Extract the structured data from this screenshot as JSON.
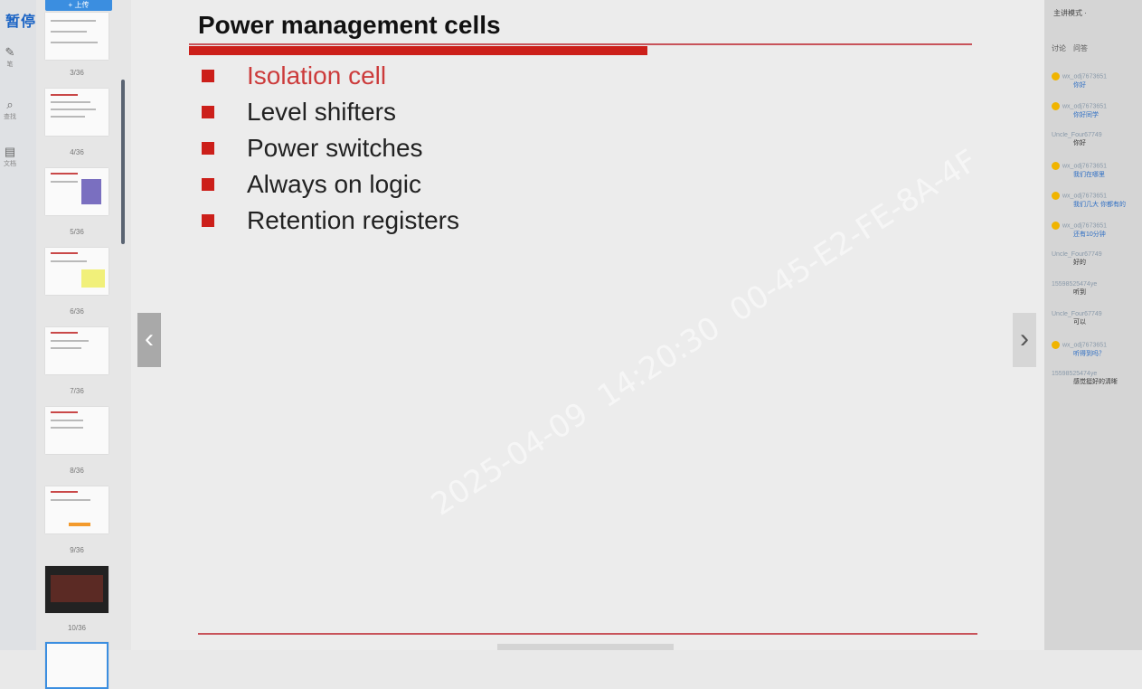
{
  "toolbar": {
    "pause_label": "暂停",
    "upload_label": "+ 上传",
    "tools": [
      {
        "icon": "pen-icon",
        "label": "笔"
      },
      {
        "icon": "search-icon",
        "label": "查找"
      },
      {
        "icon": "doc-icon",
        "label": "文档"
      }
    ]
  },
  "thumbnails": [
    {
      "label": "3/36"
    },
    {
      "label": "4/36"
    },
    {
      "label": "5/36"
    },
    {
      "label": "6/36"
    },
    {
      "label": "7/36"
    },
    {
      "label": "8/36"
    },
    {
      "label": "9/36"
    },
    {
      "label": "10/36"
    }
  ],
  "slide": {
    "title": "Power management cells",
    "bullets": [
      {
        "text": "Isolation cell",
        "active": true
      },
      {
        "text": "Level shifters",
        "active": false
      },
      {
        "text": "Power switches",
        "active": false
      },
      {
        "text": "Always on logic",
        "active": false
      },
      {
        "text": "Retention registers",
        "active": false
      }
    ],
    "prev_glyph": "‹",
    "next_glyph": "›"
  },
  "right_panel": {
    "mode_label": "主讲模式 ·",
    "tabs": [
      "讨论",
      "问答"
    ],
    "messages": [
      {
        "user": "wx_odj7673651",
        "text": "你好"
      },
      {
        "user": "wx_odj7673651",
        "text": "你好同学"
      },
      {
        "user": "Uncle_Four67749",
        "text": "你好",
        "dark": true
      },
      {
        "user": "wx_odj7673651",
        "text": "我们在哪里"
      },
      {
        "user": "wx_odj7673651",
        "text": "我们几大 你都有的"
      },
      {
        "user": "wx_odj7673651",
        "text": "还有10分钟"
      },
      {
        "user": "Uncle_Four67749",
        "text": "好的",
        "dark": true
      },
      {
        "user": "15598525474ye",
        "text": "听到",
        "dark": true
      },
      {
        "user": "Uncle_Four67749",
        "text": "可以",
        "dark": true
      },
      {
        "user": "wx_odj7673651",
        "text": "听得到吗？"
      },
      {
        "user": "15598525474ye",
        "text": "感觉挺好的清晰",
        "dark": true
      }
    ]
  },
  "watermark": {
    "date": "2025-04-09",
    "time": "14:20:30",
    "code": "00-45-E2-FE-8A-4F"
  },
  "colors": {
    "accent_red": "#cc1f1a",
    "accent_blue": "#1a63c4"
  }
}
